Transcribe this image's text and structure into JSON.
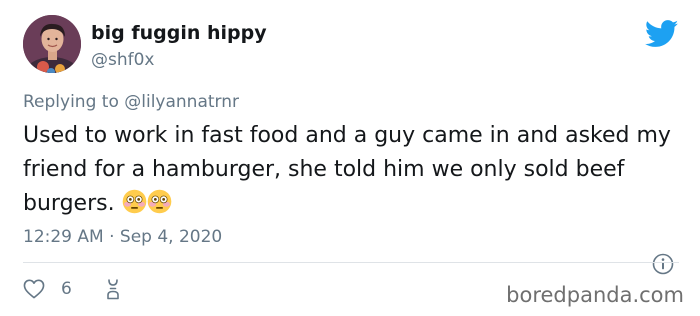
{
  "tweet": {
    "display_name": "big fuggin hippy",
    "handle": "@shf0x",
    "replying_prefix": "Replying to ",
    "replying_to": "@lilyannatrnr",
    "text": "Used to work in fast food and a guy came in and asked my friend for a hamburger, she told him we only sold beef burgers.",
    "emojis": [
      "flushed-face",
      "flushed-face"
    ],
    "timestamp": "12:29 AM · Sep 4, 2020",
    "likes": "6"
  },
  "icons": {
    "brand": "twitter-bird-icon",
    "info": "info-icon",
    "like": "heart-icon",
    "profile": "profile-icon"
  },
  "colors": {
    "twitter_blue": "#1da1f2",
    "secondary_text": "#657786",
    "primary_text": "#14171a"
  },
  "watermark": "boredpanda.com"
}
